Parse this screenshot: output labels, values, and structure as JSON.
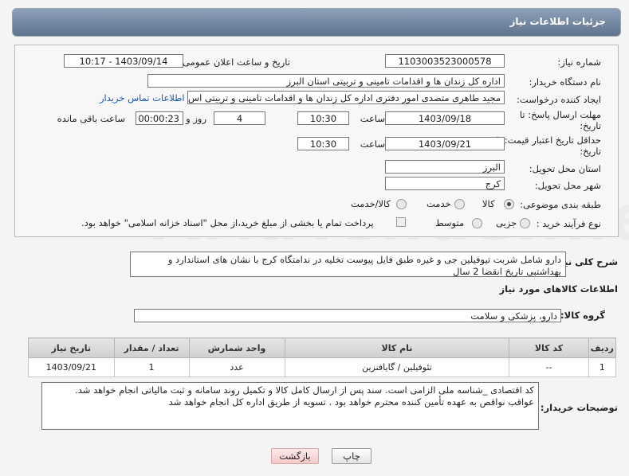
{
  "header": {
    "title": "جزئیات اطلاعات نیاز"
  },
  "fields": {
    "need_number_label": "شماره نیاز:",
    "need_number": "1103003523000578",
    "announce_label": "تاریخ و ساعت اعلان عمومی:",
    "announce_value": "1403/09/14 - 10:17",
    "buyer_org_label": "نام دستگاه خریدار:",
    "buyer_org": "اداره کل زندان ها و اقدامات تامینی و تربیتی استان البرز",
    "creator_label": "ایجاد کننده درخواست:",
    "creator": "مجید طاهری متصدی امور دفتری اداره کل زندان ها و اقدامات تامینی و تربیتی اس",
    "contact_link": "اطلاعات تماس خریدار",
    "deadline_label_1": "مهلت ارسال پاسخ: تا",
    "deadline_label_2": "تاریخ:",
    "deadline_date": "1403/09/18",
    "time_label": "ساعت",
    "deadline_time": "10:30",
    "days_value": "4",
    "days_label": "روز و",
    "remaining_time": "00:00:23",
    "remaining_label": "ساعت باقی مانده",
    "validity_label_1": "حداقل تاریخ اعتبار قیمت: تا",
    "validity_label_2": "تاریخ:",
    "validity_date": "1403/09/21",
    "validity_time": "10:30",
    "province_label": "استان محل تحویل:",
    "province": "البرز",
    "city_label": "شهر محل تحویل:",
    "city": "کرج",
    "category_label": "طبقه بندی موضوعی:",
    "category_options": [
      "کالا",
      "خدمت",
      "کالا/خدمت"
    ],
    "process_label": "نوع فرآیند خرید :",
    "process_options": [
      "جزیی",
      "متوسط"
    ],
    "payment_note": "پرداخت تمام یا بخشی از مبلغ خرید،از محل \"اسناد خزانه اسلامی\" خواهد بود."
  },
  "description": {
    "label": "شرح کلی نیاز:",
    "text": "دارو شامل شربت تیوفیلین جی و غیره طبق فایل پیوست تخلیه در ندامتگاه کرج با نشان های استاندارد و بهداشتبی تاریخ انقضا 2 سال"
  },
  "goods": {
    "section_title": "اطلاعات کالاهای مورد نیاز",
    "group_label": "گروه کالا:",
    "group_value": "دارو، پزشکی و سلامت",
    "columns": [
      "ردیف",
      "کد کالا",
      "نام کالا",
      "واحد شمارش",
      "تعداد / مقدار",
      "تاریخ نیاز"
    ],
    "rows": [
      [
        "1",
        "--",
        "تئوفیلین / گایافنزین",
        "عدد",
        "1",
        "1403/09/21"
      ]
    ]
  },
  "buyer_notes": {
    "label": "توضیحات خریدار:",
    "text": "کد اقتصادی _شناسه ملی الزامی است. سند پس از ارسال کامل کالا و تکمیل روند سامانه و ثبت مالیاتی انجام خواهد شد. عواقب نواقص به عهده تأمین کننده محترم خواهد بود . تسویه از طریق اداره کل انجام خواهد شد"
  },
  "buttons": {
    "print": "چاپ",
    "back": "بازگشت"
  }
}
